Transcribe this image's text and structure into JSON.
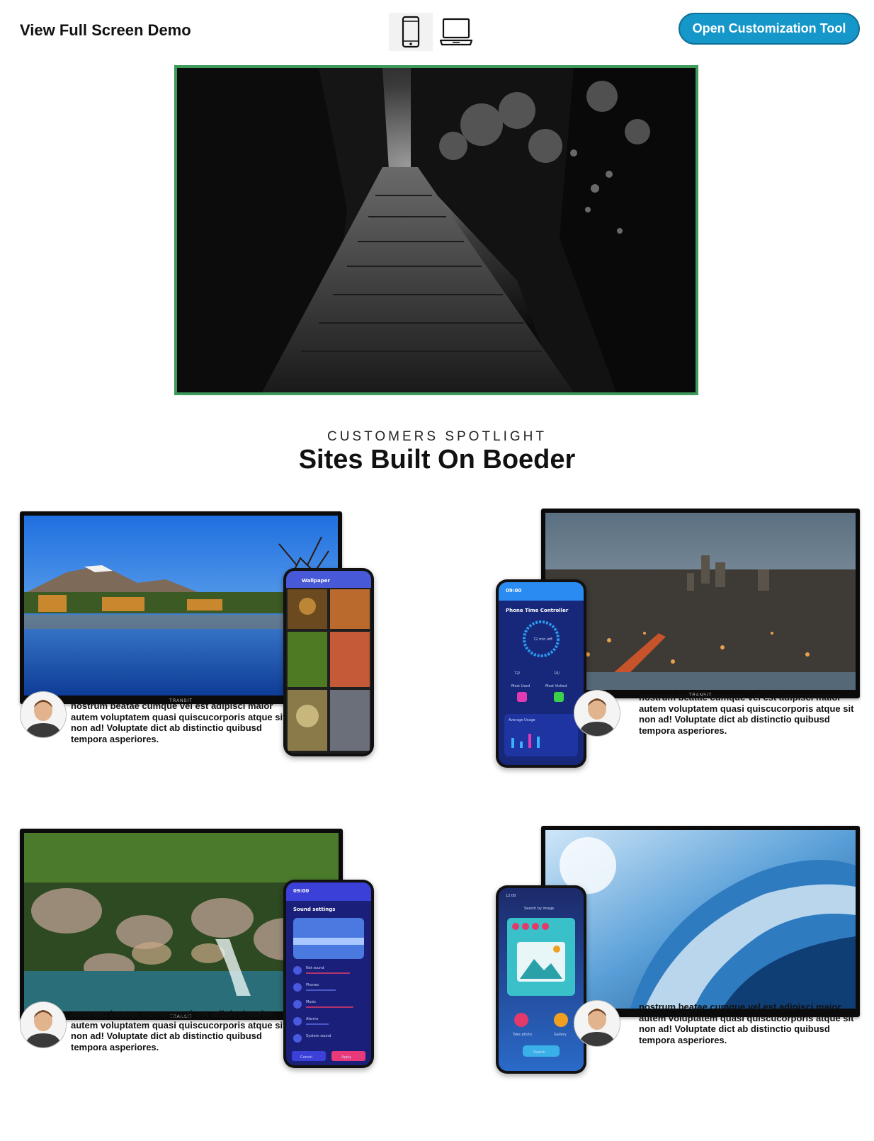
{
  "header": {
    "fullscreen_label": "View Full Screen Demo",
    "device_options": [
      {
        "name": "mobile",
        "icon": "mobile-phone-icon",
        "active": true
      },
      {
        "name": "desktop",
        "icon": "laptop-icon",
        "active": false
      }
    ],
    "cta_label": "Open Customization Tool",
    "cta_color": "#1597c9"
  },
  "hero": {
    "frame_color": "#3e9a5a",
    "image": "dark-forest-stairway"
  },
  "spotlight": {
    "eyebrow": "CUSTOMERS SPOTLIGHT",
    "title": "Sites Built On Boeder"
  },
  "showcase": [
    {
      "tv_brand": "TRANSIT",
      "phone_app": {
        "title": "Wallpaper"
      },
      "testimonial": "nostrum beatae cumque vel est adipisci maior autem voluptatem quasi quiscucorporis atque sit non ad! Voluptate dict ab distinctio quibusd tempora asperiores."
    },
    {
      "tv_brand": "TRANSIT",
      "phone_app": {
        "title": "Phone Time Controller",
        "status_time": "09:00",
        "gauge_label": "72 min left",
        "stat_a": "72/",
        "stat_b": "10/",
        "used_label": "Most Used",
        "visited_label": "Most Visited",
        "usage_label": "Average Usage"
      },
      "testimonial": "nostrum beatae cumque vel est adipisci maior autem voluptatem quasi quiscucorporis atque sit non ad! Voluptate dict ab distinctio quibusd tempora asperiores."
    },
    {
      "tv_brand": "TRANSIT",
      "phone_app": {
        "title": "Sound settings",
        "status_time": "09:00",
        "rows": [
          "Not sound",
          "Phones",
          "Music",
          "Alarms",
          "System sound"
        ],
        "cancel": "Cancel",
        "apply": "Apply"
      },
      "testimonial": "nostrum beatae cumque vel est adipisci maior autem voluptatem quasi quiscucorporis atque sit non ad! Voluptate dict ab distinctio quibusd tempora asperiores."
    },
    {
      "tv_brand": "",
      "phone_app": {
        "title": "Search by image",
        "status_time": "12:00",
        "camera": "Take photo",
        "gallery": "Gallery",
        "search": "Search"
      },
      "testimonial": "nostrum beatae cumque vel est adipisci maior autem voluptatem quasi quiscucorporis atque sit non ad! Voluptate dict ab distinctio quibusd tempora asperiores."
    }
  ]
}
